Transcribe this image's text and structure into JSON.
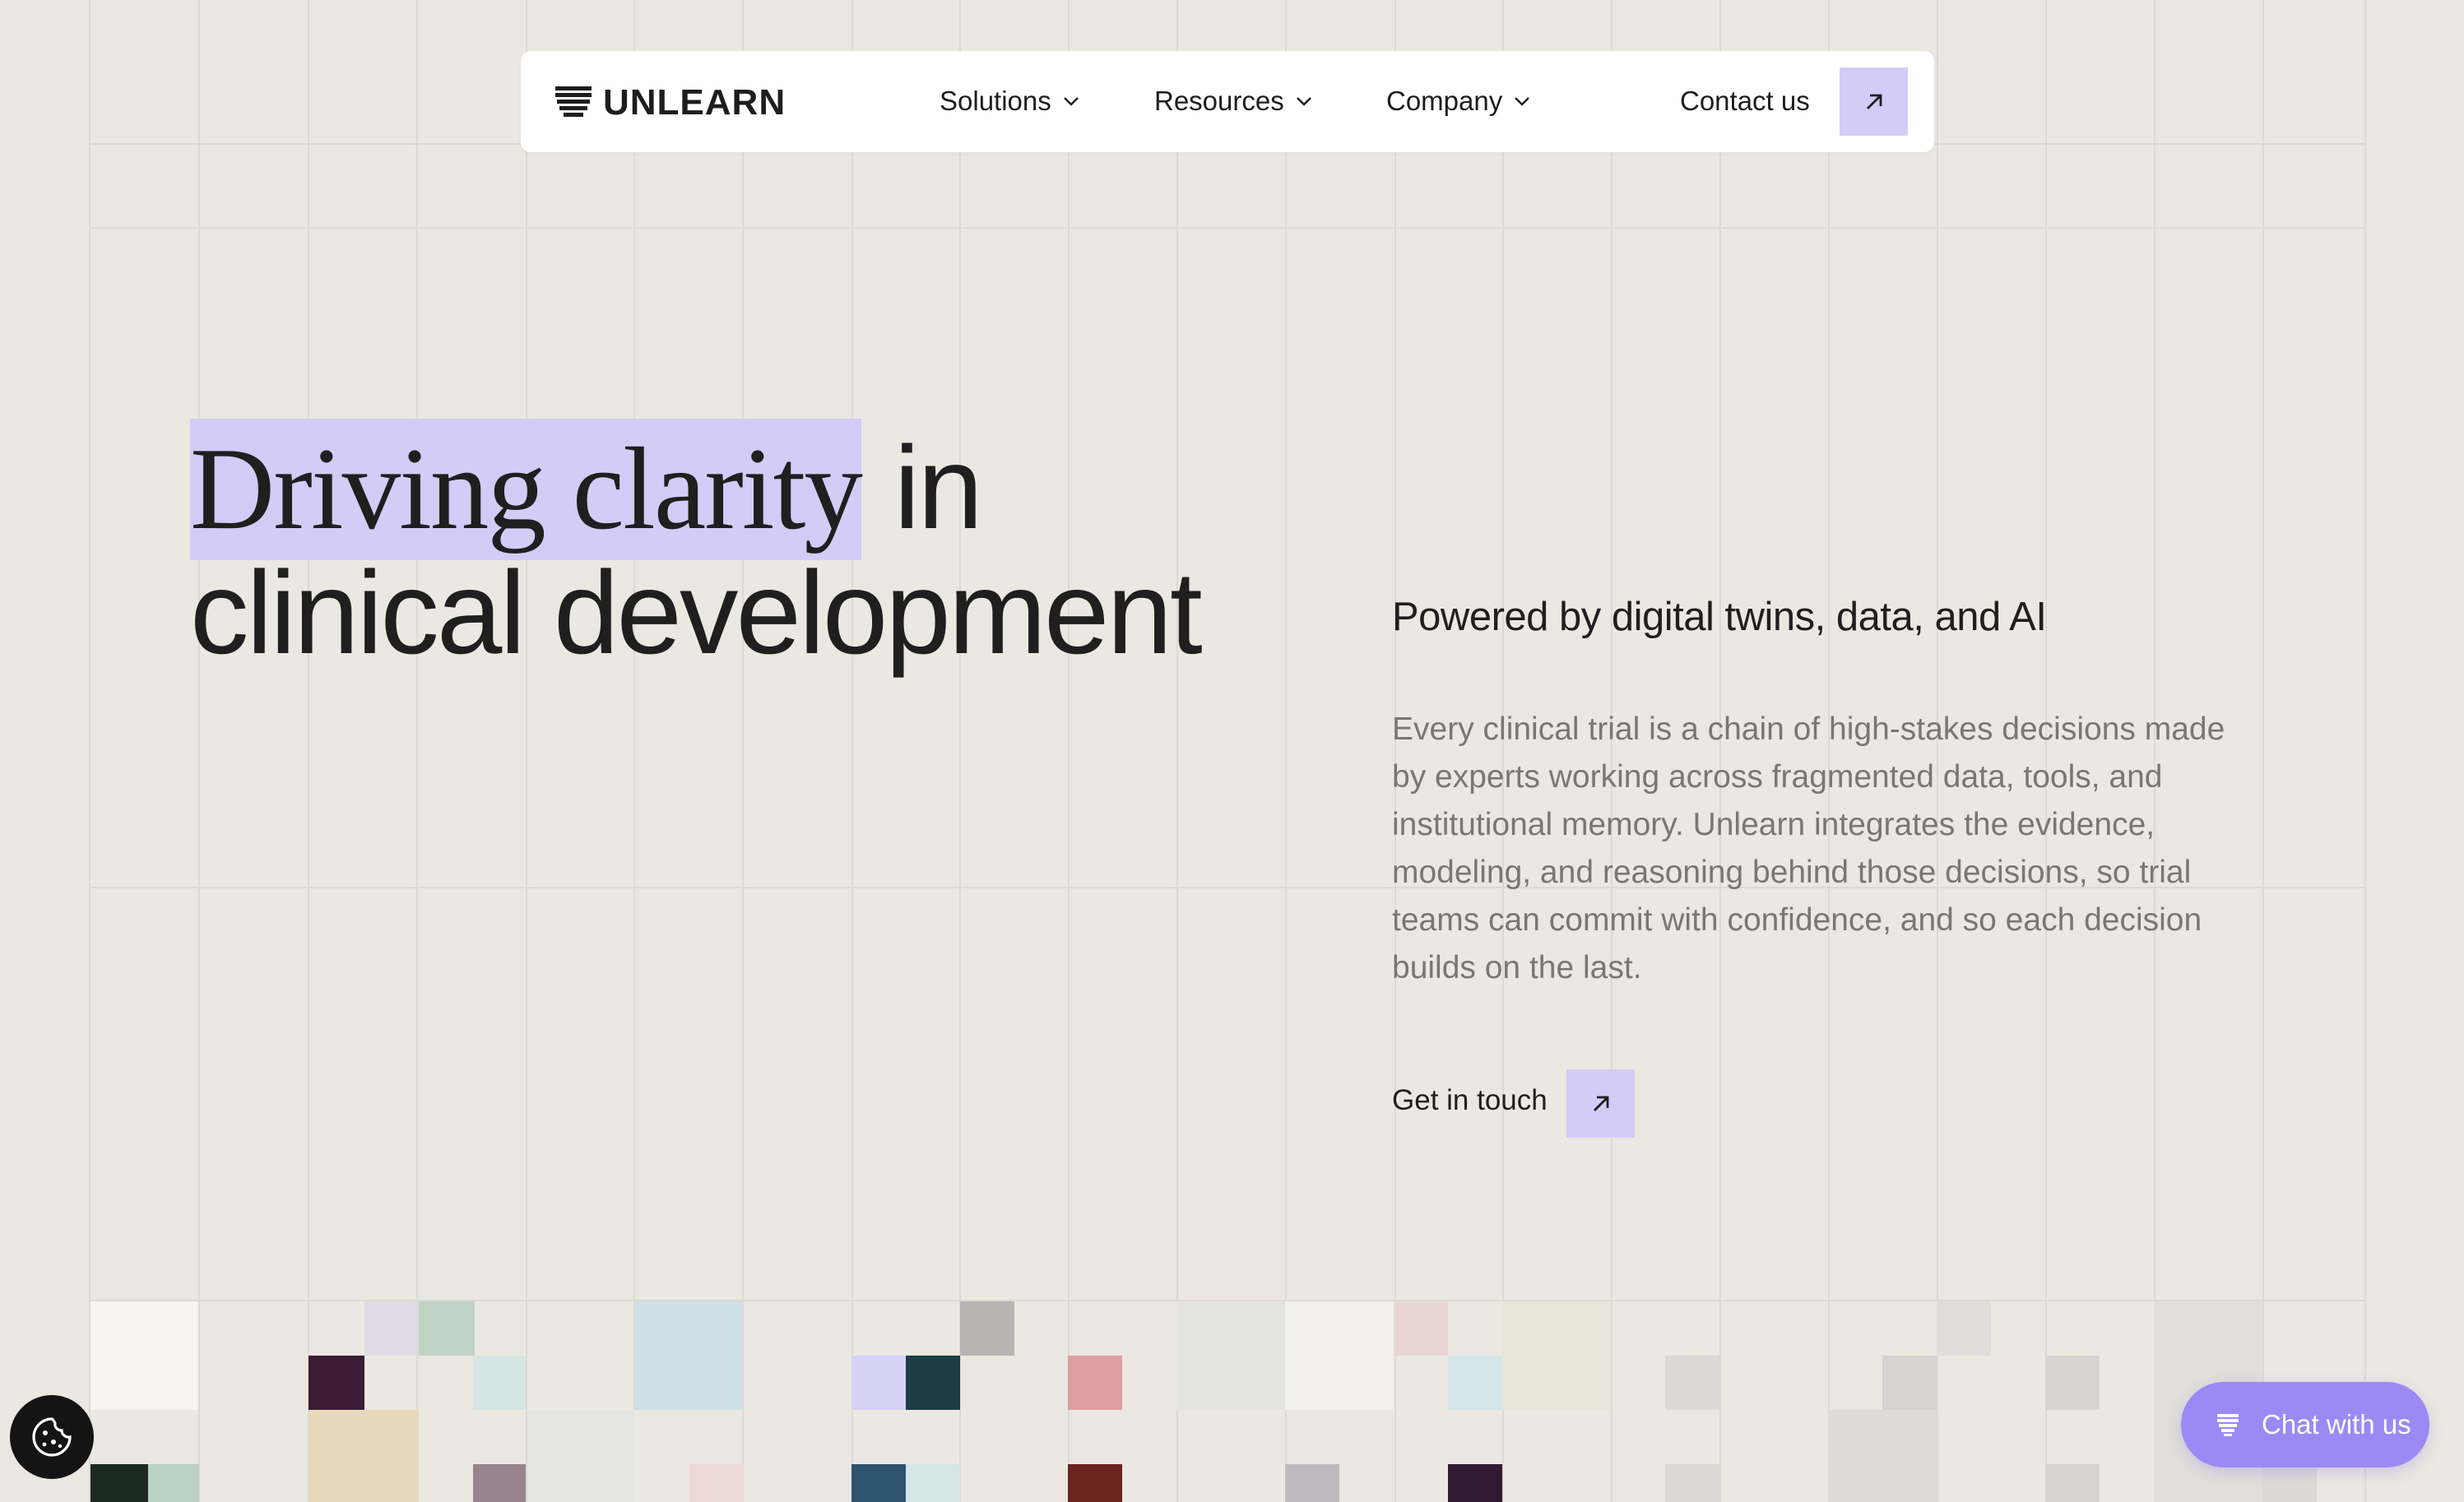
{
  "nav": {
    "brand": "UNLEARN",
    "items": [
      {
        "label": "Solutions"
      },
      {
        "label": "Resources"
      },
      {
        "label": "Company"
      }
    ],
    "contact_label": "Contact us"
  },
  "hero": {
    "title_highlight": "Driving clarity",
    "title_rest_1": "in",
    "title_line2": "clinical development",
    "subtitle": "Powered by digital twins, data, and AI",
    "body": "Every clinical trial is a chain of high-stakes decisions made by experts working across fragmented data, tools, and institutional memory. Unlearn integrates the evidence, modeling, and reasoning behind those decisions, so trial teams can commit with confidence, and so each decision builds on the last.",
    "cta_label": "Get in touch"
  },
  "chat": {
    "label": "Chat with us"
  },
  "colors": {
    "accent": "#d3ccf6",
    "chat": "#9b8af4",
    "background": "#ebe8e2"
  },
  "icons": {
    "logo": "unlearn-logo-mark",
    "chevron": "chevron-down-icon",
    "arrow": "arrow-up-right-icon",
    "cookie": "cookie-icon",
    "chat": "unlearn-logo-mark"
  }
}
